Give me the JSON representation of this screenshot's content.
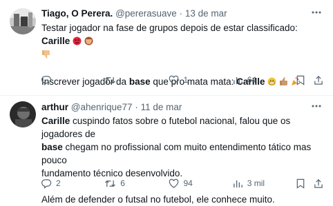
{
  "tweets": [
    {
      "display_name": "Tiago, O Perera.",
      "handle": "@pererasuave",
      "separator": "·",
      "date": "13 de mar",
      "text_line1": "Testar jogador na fase de grupos depois de estar classificado: ",
      "text_line1_bold": "Carille",
      "text_line2_pre": "Inscrever jogador da ",
      "text_line2_bold": "base",
      "text_line2_mid": " que pro mata mata: ",
      "text_line2_bold2": "Carille",
      "stats": {
        "replies": "",
        "retweets": "",
        "likes": "1",
        "views": "64"
      }
    },
    {
      "display_name": "arthur",
      "handle": "@ahenrique77",
      "separator": "·",
      "date": "11 de mar",
      "p1_bold": "Carille",
      "p1_a": " cuspindo fatos sobre o futebol nacional, falou que os jogadores de",
      "p1_bold2": "base",
      "p1_b": " chegam no profissional com muito entendimento tático mas pouco",
      "p1_c": "fundamento técnico desenvolvido.",
      "p2": "Além de defender o futsal no futebol, ele conhece muito.",
      "stats": {
        "replies": "2",
        "retweets": "6",
        "likes": "94",
        "views": "3 mil"
      }
    }
  ],
  "icons": [
    "more-icon",
    "reply-icon",
    "retweet-icon",
    "like-icon",
    "views-icon",
    "bookmark-icon",
    "share-icon"
  ],
  "colors": {
    "text": "#0f1419",
    "muted": "#536471",
    "divider": "#eff3f4"
  }
}
